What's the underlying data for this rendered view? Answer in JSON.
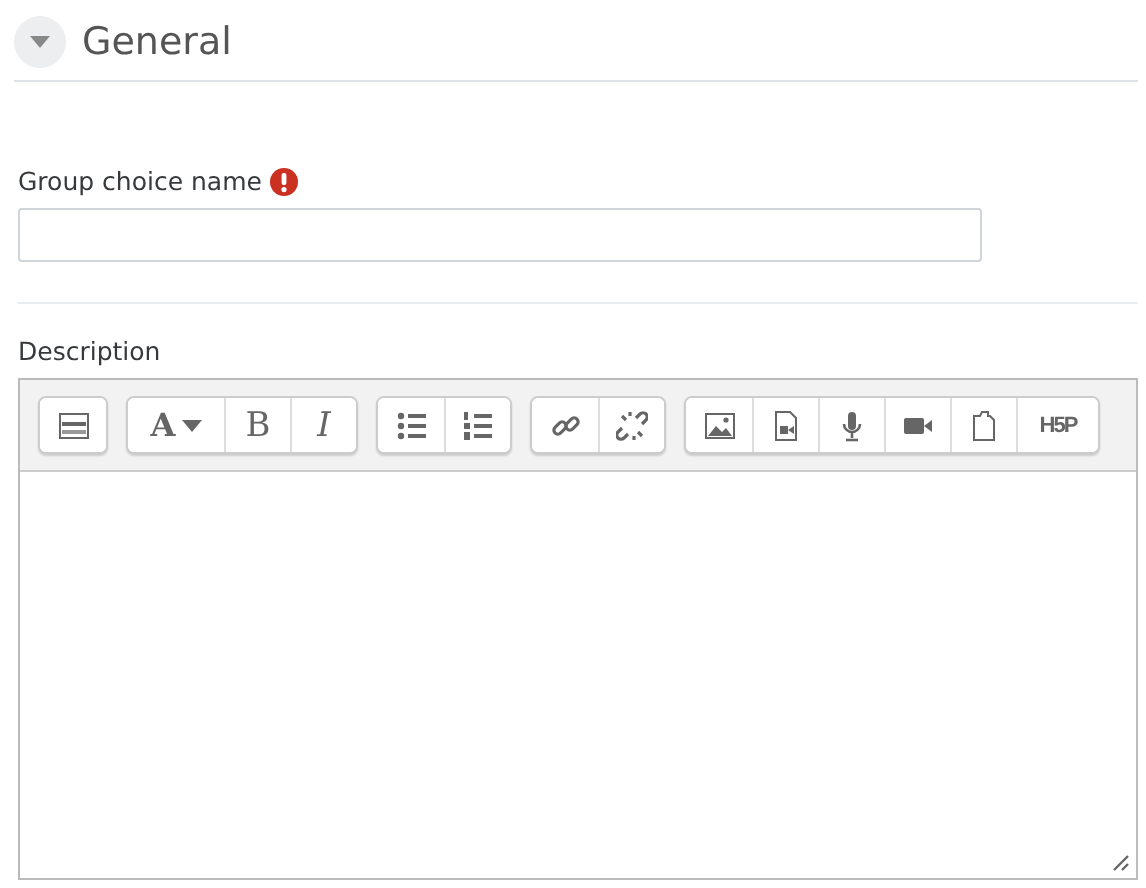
{
  "section": {
    "title": "General",
    "expanded": true
  },
  "name_field": {
    "label": "Group choice name",
    "required": true
  },
  "description": {
    "label": "Description",
    "toolbar": [
      [
        {
          "kind": "toggle"
        }
      ],
      [
        {
          "kind": "fontcolor",
          "text": "A"
        },
        {
          "kind": "bold",
          "text": "B"
        },
        {
          "kind": "italic",
          "text": "I"
        }
      ],
      [
        {
          "kind": "bullets"
        },
        {
          "kind": "numbers"
        }
      ],
      [
        {
          "kind": "link"
        },
        {
          "kind": "unlink"
        }
      ],
      [
        {
          "kind": "image"
        },
        {
          "kind": "media"
        },
        {
          "kind": "mic"
        },
        {
          "kind": "video"
        },
        {
          "kind": "files"
        },
        {
          "kind": "h5p",
          "text": "H5P"
        }
      ]
    ]
  }
}
